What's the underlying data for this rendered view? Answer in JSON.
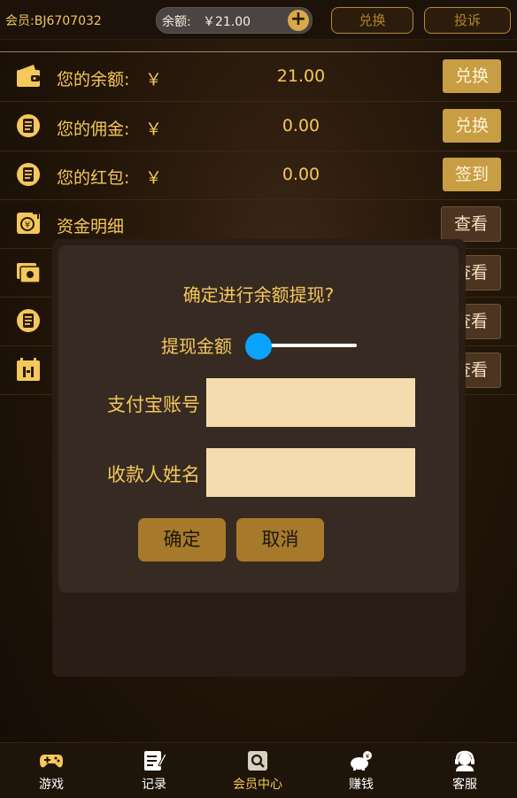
{
  "header": {
    "member_id": "会员:BJ6707032",
    "balance_label": "余额:",
    "balance_value": "￥21.00",
    "exchange_label": "兑换",
    "complain_label": "投诉"
  },
  "rows": [
    {
      "label": "您的余额:",
      "yen": "￥",
      "value": "21.00",
      "button": "兑换",
      "icon": "wallet-icon"
    },
    {
      "label": "您的佣金:",
      "yen": "￥",
      "value": "0.00",
      "button": "兑换",
      "icon": "document-icon"
    },
    {
      "label": "您的红包:",
      "yen": "￥",
      "value": "0.00",
      "button": "签到",
      "icon": "document-icon"
    },
    {
      "label": "资金明细",
      "button": "查看",
      "icon": "money-detail-icon"
    },
    {
      "button": "查看",
      "icon": "cash-icon"
    },
    {
      "button": "查看",
      "icon": "document-icon"
    },
    {
      "button": "查看",
      "icon": "calendar-icon"
    }
  ],
  "modal": {
    "title": "确定进行余额提现?",
    "amount_label": "提现金额",
    "amount_slider_fraction": 0.0,
    "alipay_label": "支付宝账号",
    "alipay_value": "",
    "name_label": "收款人姓名",
    "name_value": "",
    "confirm_label": "确定",
    "cancel_label": "取消"
  },
  "nav": [
    {
      "label": "游戏",
      "icon": "gamepad-icon",
      "active": false
    },
    {
      "label": "记录",
      "icon": "notes-icon",
      "active": false
    },
    {
      "label": "会员中心",
      "icon": "search-box-icon",
      "active": true
    },
    {
      "label": "赚钱",
      "icon": "piggy-bank-icon",
      "active": false
    },
    {
      "label": "客服",
      "icon": "headset-icon",
      "active": false
    }
  ],
  "colors": {
    "accent": "#f4c85a",
    "button_gold": "#c89e45",
    "slider_thumb": "#0aa3ff",
    "input_bg": "#f5dcae"
  }
}
